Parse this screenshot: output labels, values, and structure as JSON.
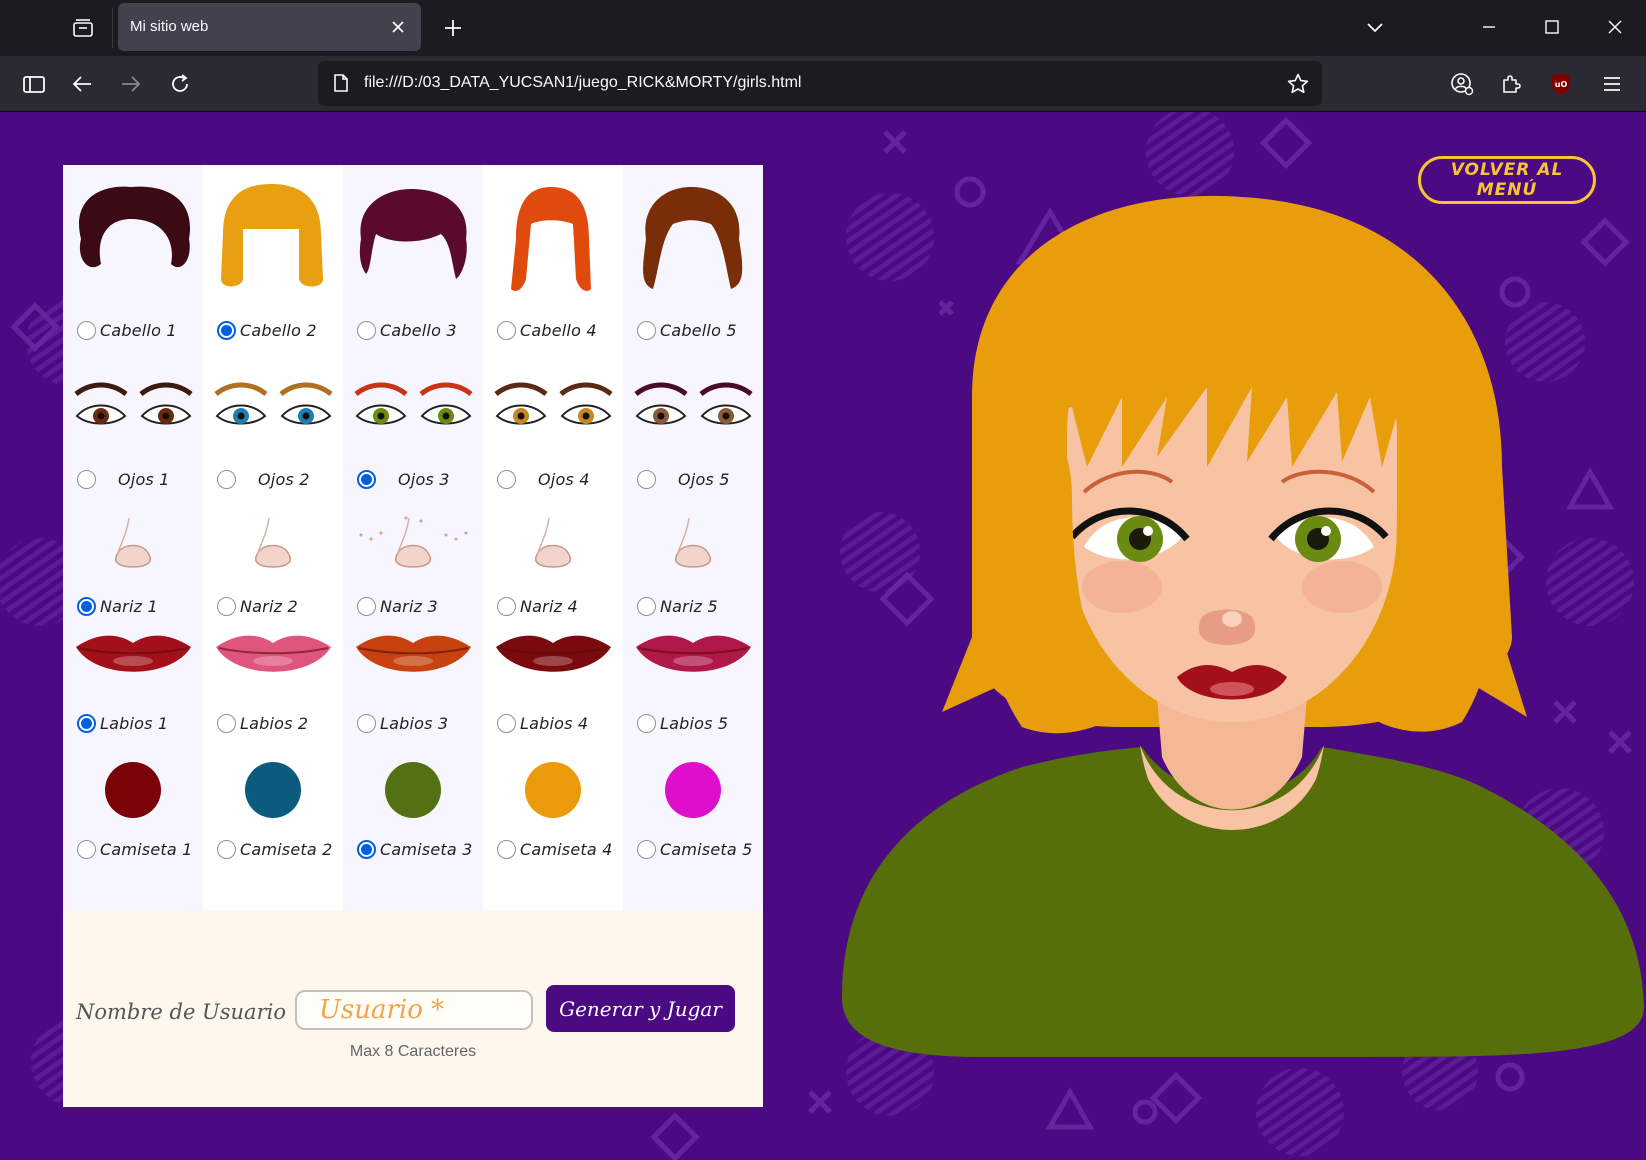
{
  "browser": {
    "tab_title": "Mi sitio web",
    "url": "file:///D:/03_DATA_YUCSAN1/juego_RICK&MORTY/girls.html"
  },
  "menu_button": "VOLVER AL MENÚ",
  "rows": {
    "hair": {
      "labels": [
        "Cabello 1",
        "Cabello 2",
        "Cabello 3",
        "Cabello 4",
        "Cabello 5"
      ],
      "colors": [
        "#3b0a14",
        "#e8a012",
        "#5a0a2c",
        "#e04a0c",
        "#7a2e08"
      ],
      "selected": 1
    },
    "eyes": {
      "labels": [
        "Ojos 1",
        "Ojos 2",
        "Ojos 3",
        "Ojos 4",
        "Ojos 5"
      ],
      "iris_colors": [
        "#6b2a0e",
        "#1e7fb0",
        "#6a8a12",
        "#c7861e",
        "#8a5a3a"
      ],
      "brow_colors": [
        "#3b1a10",
        "#b07020",
        "#c83414",
        "#5a2a14",
        "#4a0a2a"
      ],
      "selected": 2
    },
    "nose": {
      "labels": [
        "Nariz 1",
        "Nariz 2",
        "Nariz 3",
        "Nariz 4",
        "Nariz 5"
      ],
      "selected": 0
    },
    "lips": {
      "labels": [
        "Labios 1",
        "Labios 2",
        "Labios 3",
        "Labios 4",
        "Labios 5"
      ],
      "colors": [
        "#a3101a",
        "#e0557e",
        "#c7420e",
        "#7a0a0e",
        "#b0184a"
      ],
      "selected": 0
    },
    "shirt": {
      "labels": [
        "Camiseta 1",
        "Camiseta 2",
        "Camiseta 3",
        "Camiseta 4",
        "Camiseta 5"
      ],
      "colors": [
        "#7a0308",
        "#0a5b7e",
        "#537012",
        "#ea9a0a",
        "#dd0fcd"
      ],
      "selected": 2
    }
  },
  "form": {
    "label": "Nombre de Usuario",
    "placeholder": "Usuario *",
    "button": "Generar y Jugar",
    "hint": "Max 8 Caracteres"
  },
  "theme": {
    "page_bg": "#4b0a82",
    "accent": "#f7c531",
    "avatar_hair": "#e89d0a",
    "avatar_shirt": "#566f0b",
    "avatar_skin": "#f7c3a2"
  }
}
